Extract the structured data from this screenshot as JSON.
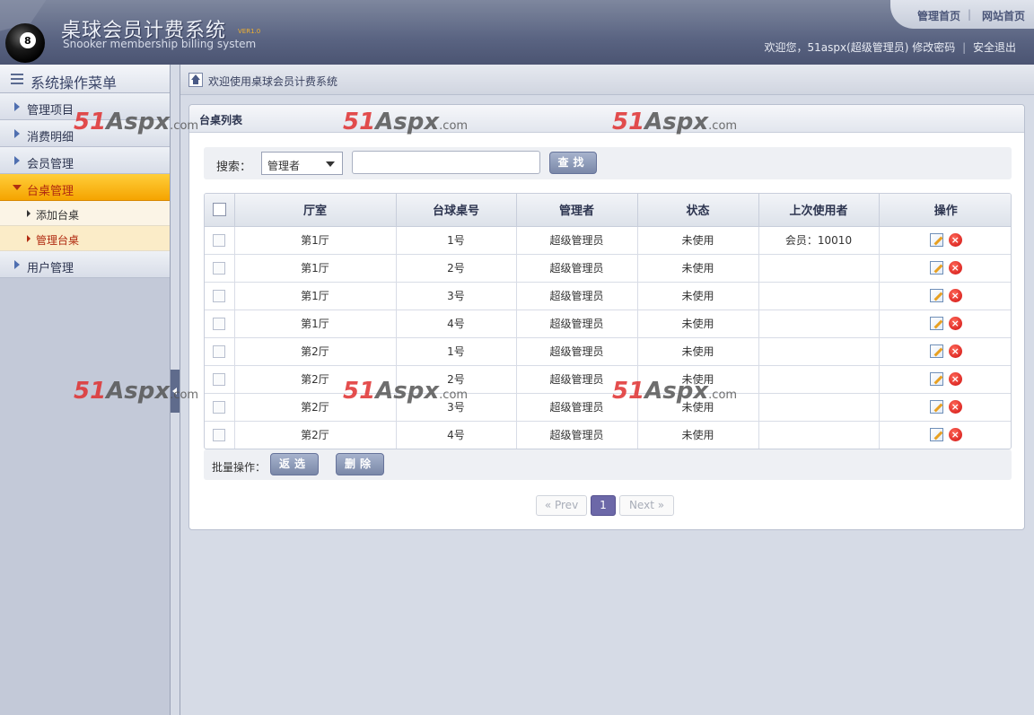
{
  "header": {
    "title_cn": "桌球会员计费系统",
    "version": "VER1.0",
    "title_en": "Snooker membership billing system",
    "links": [
      "管理首页",
      "网站首页"
    ],
    "welcome": "欢迎您，51aspx(超级管理员)",
    "change_password": "修改密码",
    "logout": "安全退出"
  },
  "sidebar": {
    "title": "系统操作菜单",
    "items": [
      {
        "label": "管理项目"
      },
      {
        "label": "消费明细"
      },
      {
        "label": "会员管理"
      },
      {
        "label": "台桌管理"
      }
    ],
    "subitems": [
      {
        "label": "添加台桌"
      },
      {
        "label": "管理台桌"
      }
    ],
    "last_item": "用户管理"
  },
  "breadcrumb": "欢迎使用桌球会员计费系统",
  "panel_title": "台桌列表",
  "search": {
    "label": "搜索：",
    "select_value": "管理者",
    "input_value": "",
    "button": "查找"
  },
  "table": {
    "headers": [
      "厅室",
      "台球桌号",
      "管理者",
      "状态",
      "上次使用者",
      "操作"
    ],
    "rows": [
      [
        "第1厅",
        "1号",
        "超级管理员",
        "未使用",
        "会员：10010"
      ],
      [
        "第1厅",
        "2号",
        "超级管理员",
        "未使用",
        ""
      ],
      [
        "第1厅",
        "3号",
        "超级管理员",
        "未使用",
        ""
      ],
      [
        "第1厅",
        "4号",
        "超级管理员",
        "未使用",
        ""
      ],
      [
        "第2厅",
        "1号",
        "超级管理员",
        "未使用",
        ""
      ],
      [
        "第2厅",
        "2号",
        "超级管理员",
        "未使用",
        ""
      ],
      [
        "第2厅",
        "3号",
        "超级管理员",
        "未使用",
        ""
      ],
      [
        "第2厅",
        "4号",
        "超级管理员",
        "未使用",
        ""
      ]
    ]
  },
  "batch": {
    "label": "批量操作：",
    "invert": "返选",
    "delete": "删除"
  },
  "pager": {
    "prev": "« Prev",
    "current": "1",
    "next": "Next »"
  },
  "watermark": {
    "brand": "51",
    "mid": "Aspx",
    "suffix": ".com"
  }
}
